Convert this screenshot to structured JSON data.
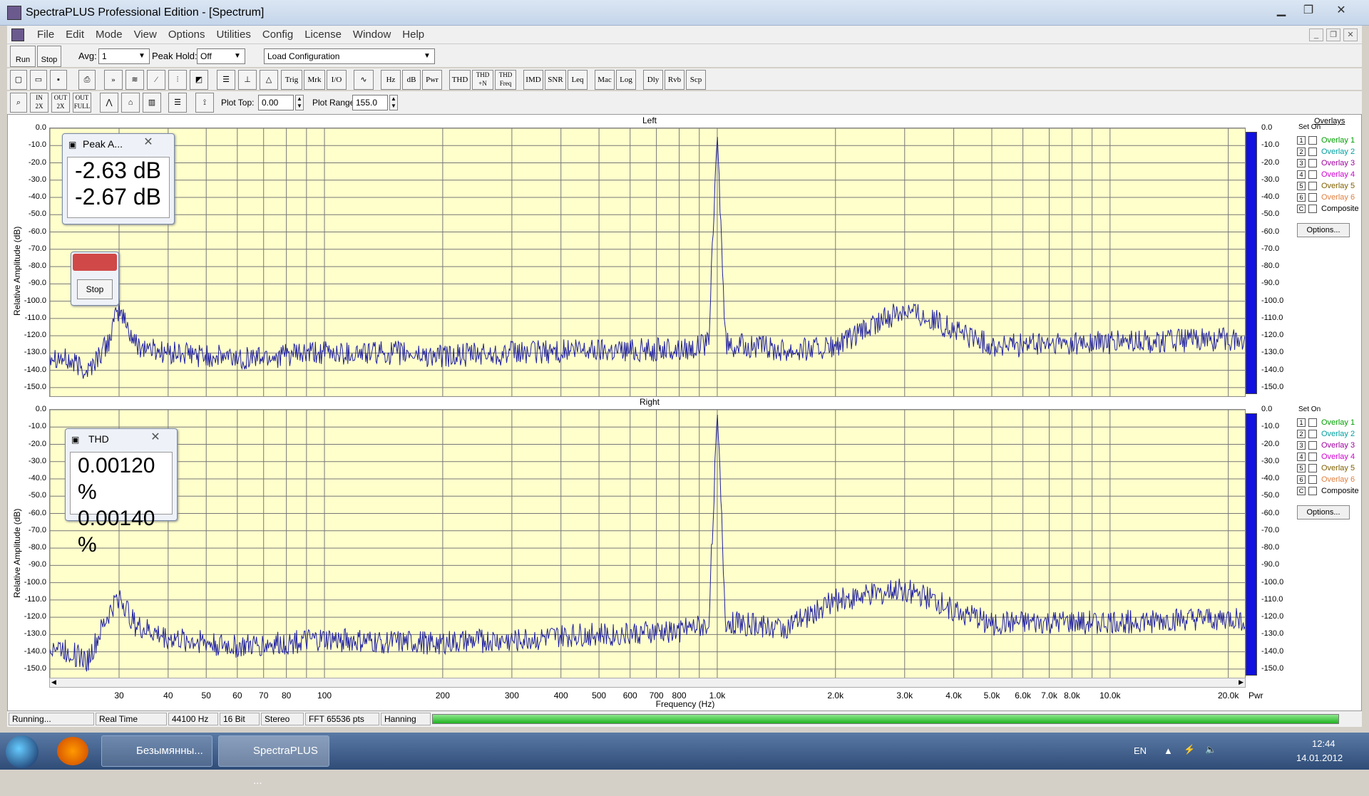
{
  "window": {
    "title": "SpectraPLUS Professional Edition - [Spectrum]"
  },
  "menu": [
    "File",
    "Edit",
    "Mode",
    "View",
    "Options",
    "Utilities",
    "Config",
    "License",
    "Window",
    "Help"
  ],
  "toolbar1": {
    "run": "Run",
    "stop": "Stop",
    "avg_label": "Avg:",
    "avg_value": "1",
    "peak_hold_label": "Peak Hold:",
    "peak_hold_value": "Off",
    "config_value": "Load Configuration"
  },
  "toolbar2": [
    "Trig",
    "Mrk",
    "I/O",
    "Hz",
    "dB",
    "Pwr",
    "THD",
    "THD +N",
    "THD Freq",
    "IMD",
    "SNR",
    "Leq",
    "Mac",
    "Log",
    "Dly",
    "Rvb",
    "Scp"
  ],
  "toolbar3": {
    "zoom": [
      "2X",
      "2X",
      "FULL"
    ],
    "zoom_prefix": [
      "IN",
      "OUT",
      "OUT"
    ],
    "plot_top_label": "Plot Top:",
    "plot_top_value": "0.00",
    "plot_range_label": "Plot Range:",
    "plot_range_value": "155.0"
  },
  "plots": [
    {
      "title": "Left",
      "ylabel": "Relative Amplitude (dB)"
    },
    {
      "title": "Right",
      "ylabel": "Relative Amplitude (dB)"
    }
  ],
  "yticks": [
    "0.0",
    "-10.0",
    "-20.0",
    "-30.0",
    "-40.0",
    "-50.0",
    "-60.0",
    "-70.0",
    "-80.0",
    "-90.0",
    "-100.0",
    "-110.0",
    "-120.0",
    "-130.0",
    "-140.0",
    "-150.0"
  ],
  "xticks": [
    "30",
    "40",
    "50",
    "60",
    "70",
    "80",
    "100",
    "200",
    "300",
    "400",
    "500",
    "600",
    "700",
    "800",
    "1.0k",
    "2.0k",
    "3.0k",
    "4.0k",
    "5.0k",
    "6.0k",
    "7.0k",
    "8.0k",
    "10.0k",
    "20.0k"
  ],
  "xlabel": "Frequency (Hz)",
  "meter_label": "Pwr",
  "overlays": {
    "title": "Overlays",
    "set_label": "Set",
    "on_label": "On",
    "items": [
      {
        "num": "1",
        "label": "Overlay 1",
        "color": "#00a000"
      },
      {
        "num": "2",
        "label": "Overlay 2",
        "color": "#00a0a0"
      },
      {
        "num": "3",
        "label": "Overlay 3",
        "color": "#a000a0"
      },
      {
        "num": "4",
        "label": "Overlay 4",
        "color": "#d000d0"
      },
      {
        "num": "5",
        "label": "Overlay 5",
        "color": "#806000"
      },
      {
        "num": "6",
        "label": "Overlay 6",
        "color": "#e08040"
      },
      {
        "num": "C",
        "label": "Composite",
        "color": "#000000"
      }
    ],
    "options": "Options..."
  },
  "peak_window": {
    "title": "Peak A...",
    "values": [
      "-2.63 dB",
      "-2.67 dB"
    ]
  },
  "stop_window": {
    "button": "Stop"
  },
  "thd_window": {
    "title": "THD",
    "values": [
      "0.00120 %",
      "0.00140 %"
    ]
  },
  "status": [
    "Running...",
    "Real Time",
    "44100 Hz",
    "16 Bit",
    "Stereo",
    "FFT 65536 pts",
    "Hanning"
  ],
  "taskbar": {
    "items": [
      "Безымянны...",
      "SpectraPLUS ..."
    ],
    "lang": "EN",
    "time": "12:44",
    "date": "14.01.2012"
  },
  "chart_data": {
    "type": "line",
    "x_scale": "log",
    "xlim": [
      20,
      22050
    ],
    "ylim": [
      -155,
      0
    ],
    "series": [
      {
        "name": "Left",
        "points": [
          [
            20,
            -130
          ],
          [
            25,
            -140
          ],
          [
            28,
            -125
          ],
          [
            30,
            -104
          ],
          [
            33,
            -125
          ],
          [
            40,
            -130
          ],
          [
            60,
            -133
          ],
          [
            100,
            -130
          ],
          [
            150,
            -130
          ],
          [
            200,
            -132
          ],
          [
            300,
            -130
          ],
          [
            500,
            -128
          ],
          [
            800,
            -128
          ],
          [
            950,
            -125
          ],
          [
            1000,
            -2.6
          ],
          [
            1050,
            -125
          ],
          [
            1500,
            -128
          ],
          [
            2000,
            -127
          ],
          [
            3000,
            -104
          ],
          [
            5000,
            -126
          ],
          [
            10000,
            -124
          ],
          [
            20000,
            -122
          ]
        ]
      },
      {
        "name": "Right",
        "points": [
          [
            20,
            -135
          ],
          [
            25,
            -145
          ],
          [
            28,
            -120
          ],
          [
            30,
            -107
          ],
          [
            33,
            -125
          ],
          [
            40,
            -132
          ],
          [
            60,
            -137
          ],
          [
            100,
            -133
          ],
          [
            150,
            -135
          ],
          [
            200,
            -135
          ],
          [
            300,
            -133
          ],
          [
            500,
            -130
          ],
          [
            800,
            -128
          ],
          [
            950,
            -125
          ],
          [
            1000,
            -0.5
          ],
          [
            1050,
            -123
          ],
          [
            1500,
            -126
          ],
          [
            2000,
            -110
          ],
          [
            3000,
            -104
          ],
          [
            5000,
            -124
          ],
          [
            10000,
            -123
          ],
          [
            20000,
            -121
          ]
        ]
      }
    ]
  }
}
